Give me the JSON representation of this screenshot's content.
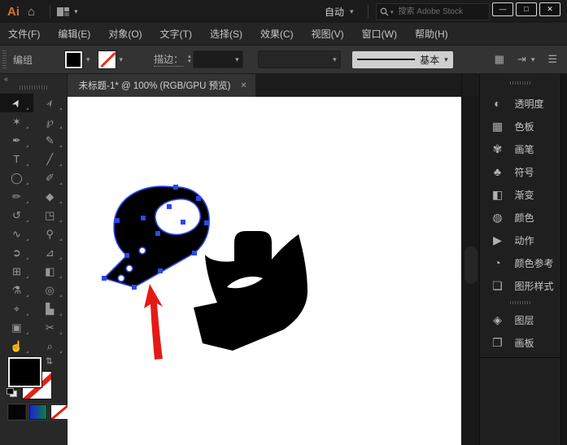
{
  "window": {
    "minimize": "—",
    "maximize": "□",
    "close": "✕"
  },
  "titlebar": {
    "logo": "Ai",
    "mode_label": "自动",
    "search_placeholder": "搜索 Adobe Stock"
  },
  "menubar": {
    "items": [
      "文件(F)",
      "编辑(E)",
      "对象(O)",
      "文字(T)",
      "选择(S)",
      "效果(C)",
      "视图(V)",
      "窗口(W)",
      "帮助(H)"
    ]
  },
  "controlbar": {
    "context_label": "编组",
    "stroke_label": "描边：",
    "stroke_style_label": "基本"
  },
  "tabstrip": {
    "active_tab_title": "未标题-1* @ 100% (RGB/GPU 预览)",
    "close": "✕"
  },
  "tooldock": {
    "collapse_glyph": "«",
    "tools": [
      {
        "name": "selection-tool",
        "glyph": "➤",
        "active": true
      },
      {
        "name": "direct-selection-tool",
        "glyph": "➢"
      },
      {
        "name": "magic-wand-tool",
        "glyph": "✶"
      },
      {
        "name": "lasso-tool",
        "glyph": "℘"
      },
      {
        "name": "pen-tool",
        "glyph": "✒"
      },
      {
        "name": "curvature-tool",
        "glyph": "✎"
      },
      {
        "name": "type-tool",
        "glyph": "T"
      },
      {
        "name": "line-segment-tool",
        "glyph": "╱"
      },
      {
        "name": "ellipse-tool",
        "glyph": "◯"
      },
      {
        "name": "paintbrush-tool",
        "glyph": "✐"
      },
      {
        "name": "pencil-tool",
        "glyph": "✏"
      },
      {
        "name": "eraser-tool",
        "glyph": "◆"
      },
      {
        "name": "rotate-tool",
        "glyph": "↺"
      },
      {
        "name": "scale-tool",
        "glyph": "◳"
      },
      {
        "name": "width-tool",
        "glyph": "∿"
      },
      {
        "name": "puppet-warp-tool",
        "glyph": "⚲"
      },
      {
        "name": "shape-builder-tool",
        "glyph": "➲"
      },
      {
        "name": "perspective-grid-tool",
        "glyph": "⊿"
      },
      {
        "name": "mesh-tool",
        "glyph": "⊞"
      },
      {
        "name": "gradient-tool",
        "glyph": "◧"
      },
      {
        "name": "eyedropper-tool",
        "glyph": "⚗"
      },
      {
        "name": "blend-tool",
        "glyph": "◎"
      },
      {
        "name": "symbol-sprayer-tool",
        "glyph": "⌖"
      },
      {
        "name": "column-graph-tool",
        "glyph": "▙"
      },
      {
        "name": "artboard-tool",
        "glyph": "▣"
      },
      {
        "name": "slice-tool",
        "glyph": "✂"
      },
      {
        "name": "hand-tool",
        "glyph": "☝"
      },
      {
        "name": "zoom-tool",
        "glyph": "⌕"
      }
    ]
  },
  "rightdock": {
    "group1": [
      {
        "name": "transparency",
        "glyph": "◐",
        "label": "透明度"
      },
      {
        "name": "swatches",
        "glyph": "▦",
        "label": "色板"
      },
      {
        "name": "brushes",
        "glyph": "✾",
        "label": "画笔"
      },
      {
        "name": "symbols",
        "glyph": "♣",
        "label": "符号"
      },
      {
        "name": "gradient",
        "glyph": "◧",
        "label": "渐变"
      },
      {
        "name": "color",
        "glyph": "◍",
        "label": "颜色"
      },
      {
        "name": "actions",
        "glyph": "▶",
        "label": "动作"
      },
      {
        "name": "color-guide",
        "glyph": "◔",
        "label": "颜色参考"
      },
      {
        "name": "graphic-styles",
        "glyph": "❏",
        "label": "图形样式"
      }
    ],
    "group2": [
      {
        "name": "layers",
        "glyph": "◈",
        "label": "图层"
      },
      {
        "name": "artboards",
        "glyph": "❐",
        "label": "画板"
      }
    ]
  },
  "icons": {
    "home": "⌂",
    "chevron-down": "▾",
    "stepper-up": "▴",
    "stepper-down": "▾",
    "align-grid": "▦",
    "transform-again": "⇥",
    "panel-list": "☰",
    "swap-arrows": "⇄"
  },
  "colors": {
    "selection_blue": "#2B49E8",
    "arrow_red": "#E51A16",
    "logo_orange": "#D3722E",
    "canvas": "#FFFFFF",
    "artwork": "#000000"
  }
}
